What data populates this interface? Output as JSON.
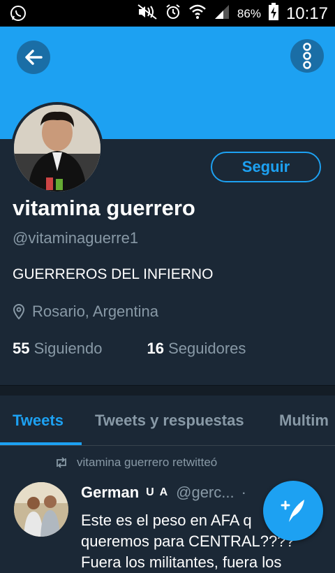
{
  "status_bar": {
    "battery": "86%",
    "time": "10:17",
    "icons": [
      "whatsapp-icon",
      "mute-icon",
      "alarm-icon",
      "wifi-icon",
      "signal-icon",
      "battery-charging-icon"
    ]
  },
  "header": {
    "back_icon": "arrow-left-icon",
    "more_icon": "more-vertical-icon",
    "accent": "#1da1f2"
  },
  "profile": {
    "follow_label": "Seguir",
    "name": "vitamina guerrero",
    "handle": "@vitaminaguerre1",
    "bio": "GUERREROS DEL INFIERNO",
    "location": "Rosario, Argentina",
    "following_count": "55",
    "following_label": "Siguiendo",
    "followers_count": "16",
    "followers_label": "Seguidores"
  },
  "tabs": [
    {
      "label": "Tweets",
      "active": true
    },
    {
      "label": "Tweets y respuestas",
      "active": false
    },
    {
      "label": "Multim",
      "active": false
    }
  ],
  "feed": {
    "retweet_text": "vitamina guerrero retwitteó",
    "tweet": {
      "author": "German",
      "flag": "U A",
      "handle": "@gerc...",
      "dot": "·",
      "body_line1": "Este es el peso en AFA q",
      "body_line2": "queremos para CENTRAL????",
      "body_line3": "Fuera los militantes, fuera los"
    }
  },
  "fab": {
    "icon": "compose-tweet-icon"
  }
}
